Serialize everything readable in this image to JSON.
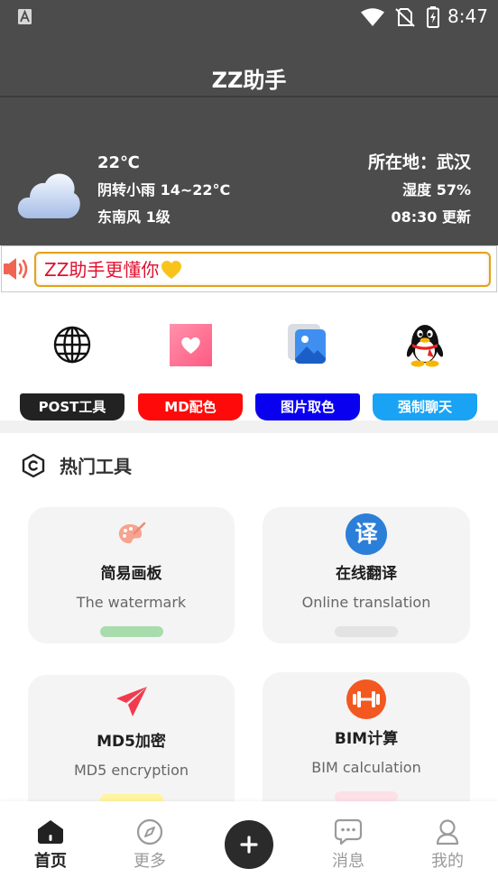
{
  "status_bar": {
    "time": "8:47",
    "icons": [
      "autofill-a-icon",
      "wifi-icon",
      "no-sim-icon",
      "battery-charging-icon"
    ]
  },
  "app_bar": {
    "title": "ZZ助手"
  },
  "weather": {
    "icon": "cloud-icon",
    "temperature": "22℃",
    "forecast": "阴转小雨 14~22°C",
    "wind": "东南风 1级",
    "location": "所在地：武汉",
    "humidity": "湿度 57%",
    "updated": "08:30 更新"
  },
  "notice": {
    "icon": "speaker-icon",
    "text": "ZZ助手更懂你",
    "trailing_icon": "yellow-heart-icon",
    "text_color": "#e0102f",
    "border_color": "#e3a21a"
  },
  "quick_tools": [
    {
      "icon": "globe-icon",
      "label": "POST工具",
      "color": "#222222"
    },
    {
      "icon": "pink-heart-icon",
      "label": "MD配色",
      "color": "#ff0a0a"
    },
    {
      "icon": "image-icon",
      "label": "图片取色",
      "color": "#0a00f0"
    },
    {
      "icon": "qq-penguin-icon",
      "label": "强制聊天",
      "color": "#1aa3f5"
    }
  ],
  "hot_tools": {
    "icon": "hexagon-icon",
    "title": "热门工具",
    "cards": [
      {
        "icon": "palette-icon",
        "title": "简易画板",
        "subtitle": "The watermark",
        "accent": "#a9dcac"
      },
      {
        "icon": "translate-icon",
        "icon_text": "译",
        "title": "在线翻译",
        "subtitle": "Online translation",
        "accent": "#e3e3e3"
      },
      {
        "icon": "paper-plane-icon",
        "title": "MD5加密",
        "subtitle": "MD5 encryption",
        "accent": "#fff5a0"
      },
      {
        "icon": "dumbbell-icon",
        "title": "BIM计算",
        "subtitle": "BIM calculation",
        "accent": "#fde1e7"
      }
    ]
  },
  "bottom_nav": {
    "items": [
      {
        "icon": "home-icon",
        "label": "首页",
        "active": true
      },
      {
        "icon": "compass-icon",
        "label": "更多",
        "active": false
      },
      {
        "icon": "plus-icon",
        "active": false
      },
      {
        "icon": "chat-icon",
        "label": "消息",
        "active": false
      },
      {
        "icon": "person-icon",
        "label": "我的",
        "active": false
      }
    ]
  }
}
